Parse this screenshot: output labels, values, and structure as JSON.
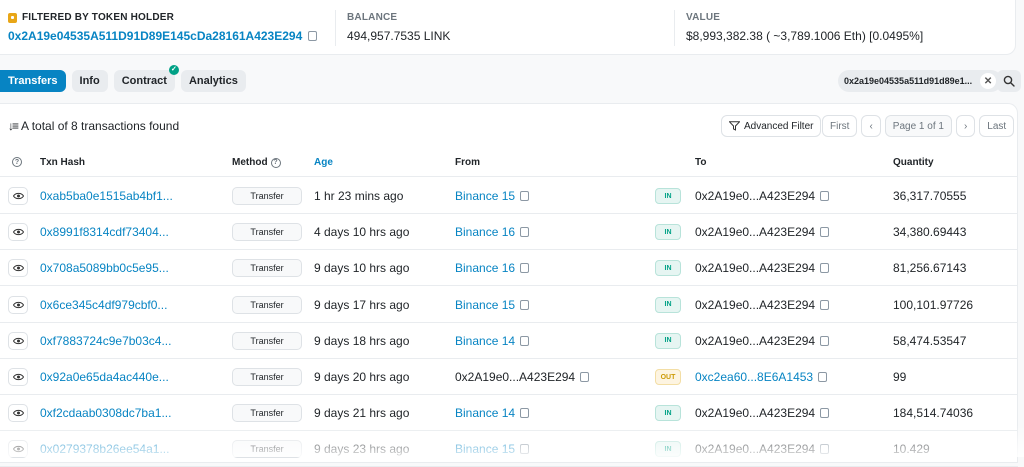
{
  "summary": {
    "holder_label": "FILTERED BY TOKEN HOLDER",
    "holder_address": "0x2A19e04535A511D91D89E145cDa28161A423E294",
    "balance_label": "BALANCE",
    "balance_value": "494,957.7535 LINK",
    "value_label": "VALUE",
    "value_value": "$8,993,382.38 ( ~3,789.1006 Eth) [0.0495%]"
  },
  "tabs": [
    {
      "label": "Transfers",
      "active": true
    },
    {
      "label": "Info"
    },
    {
      "label": "Contract"
    },
    {
      "label": "Analytics"
    }
  ],
  "filter_chip": "0x2a19e04535a511d91d89e1...",
  "table_toolbar": {
    "total_text": "A total of 8 transactions found",
    "advanced_filter": "Advanced Filter",
    "first": "First",
    "page_info": "Page 1 of 1",
    "last": "Last"
  },
  "columns": {
    "hash": "Txn Hash",
    "method": "Method",
    "age": "Age",
    "from": "From",
    "to": "To",
    "quantity": "Quantity"
  },
  "rows": [
    {
      "hash": "0xab5ba0e1515ab4bf1...",
      "method": "Transfer",
      "age": "1 hr 23 mins ago",
      "from": "Binance 15",
      "dir": "IN",
      "to": "0x2A19e0...A423E294",
      "qty": "36,317.70555"
    },
    {
      "hash": "0x8991f8314cdf73404...",
      "method": "Transfer",
      "age": "4 days 10 hrs ago",
      "from": "Binance 16",
      "dir": "IN",
      "to": "0x2A19e0...A423E294",
      "qty": "34,380.69443"
    },
    {
      "hash": "0x708a5089bb0c5e95...",
      "method": "Transfer",
      "age": "9 days 10 hrs ago",
      "from": "Binance 16",
      "dir": "IN",
      "to": "0x2A19e0...A423E294",
      "qty": "81,256.67143"
    },
    {
      "hash": "0x6ce345c4df979cbf0...",
      "method": "Transfer",
      "age": "9 days 17 hrs ago",
      "from": "Binance 15",
      "dir": "IN",
      "to": "0x2A19e0...A423E294",
      "qty": "100,101.97726"
    },
    {
      "hash": "0xf7883724c9e7b03c4...",
      "method": "Transfer",
      "age": "9 days 18 hrs ago",
      "from": "Binance 14",
      "dir": "IN",
      "to": "0x2A19e0...A423E294",
      "qty": "58,474.53547"
    },
    {
      "hash": "0x92a0e65da4ac440e...",
      "method": "Transfer",
      "age": "9 days 20 hrs ago",
      "from": "0x2A19e0...A423E294",
      "dir": "OUT",
      "to": "0xc2ea60...8E6A1453",
      "qty": "99"
    },
    {
      "hash": "0xf2cdaab0308dc7ba1...",
      "method": "Transfer",
      "age": "9 days 21 hrs ago",
      "from": "Binance 14",
      "dir": "IN",
      "to": "0x2A19e0...A423E294",
      "qty": "184,514.74036"
    },
    {
      "hash": "0x0279378b26ee54a1...",
      "method": "Transfer",
      "age": "9 days 23 hrs ago",
      "from": "Binance 15",
      "dir": "IN",
      "to": "0x2A19e0...A423E294",
      "qty": "10.429"
    }
  ]
}
